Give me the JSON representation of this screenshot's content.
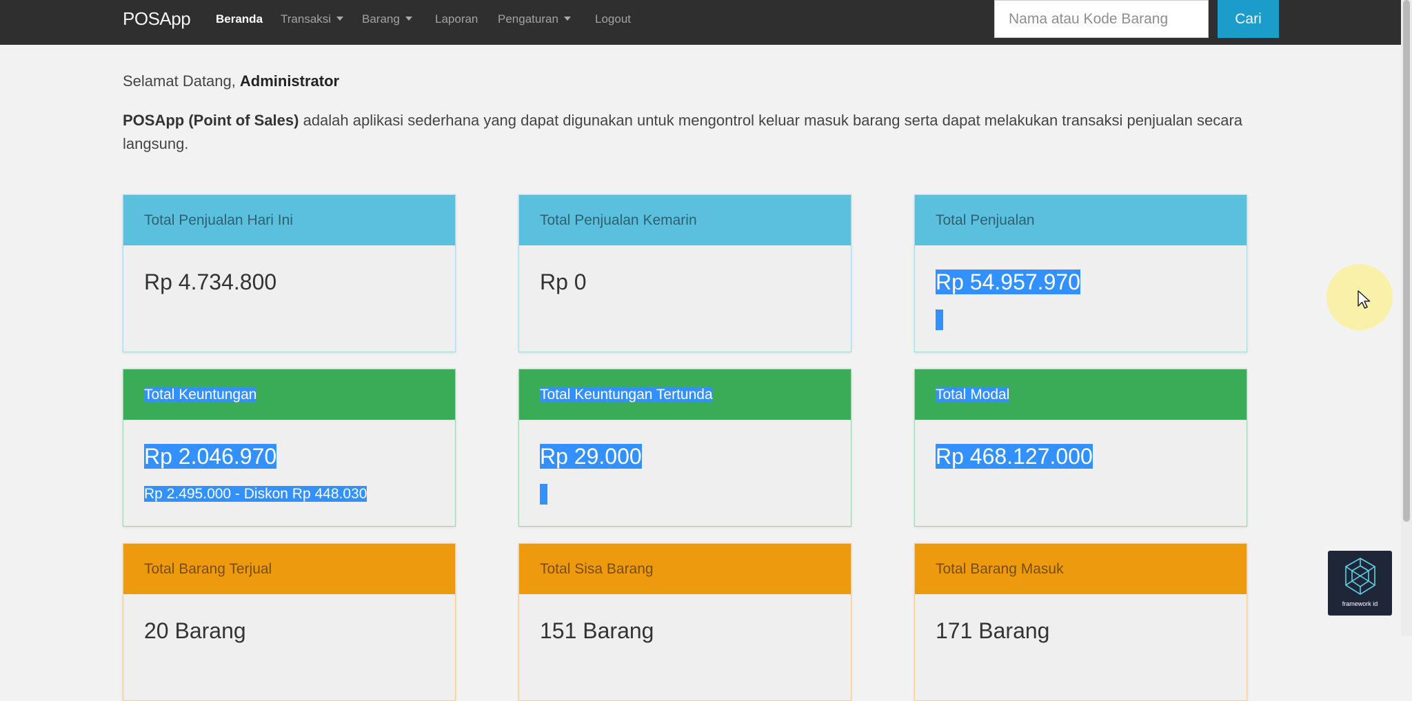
{
  "app": {
    "brand": "POSApp"
  },
  "nav": {
    "items": [
      {
        "label": "Beranda",
        "active": true,
        "dropdown": false
      },
      {
        "label": "Transaksi",
        "active": false,
        "dropdown": true
      },
      {
        "label": "Barang",
        "active": false,
        "dropdown": true
      },
      {
        "label": "Laporan",
        "active": false,
        "dropdown": false
      },
      {
        "label": "Pengaturan",
        "active": false,
        "dropdown": true
      },
      {
        "label": "Logout",
        "active": false,
        "dropdown": false
      }
    ]
  },
  "search": {
    "placeholder": "Nama atau Kode Barang",
    "value": "",
    "button_label": "Cari"
  },
  "welcome": {
    "prefix": "Selamat Datang,",
    "user": "Administrator"
  },
  "description": {
    "strong": "POSApp (Point of Sales)",
    "text": " adalah aplikasi sederhana yang dapat digunakan untuk mengontrol keluar masuk barang serta dapat melakukan transaksi penjualan secara langsung."
  },
  "cards": [
    {
      "variant": "info",
      "title": "Total Penjualan Hari Ini",
      "value": "Rp 4.734.800",
      "note": "",
      "title_selected": false,
      "value_selected": false,
      "note_selected": false,
      "blank_selected": false
    },
    {
      "variant": "info",
      "title": "Total Penjualan Kemarin",
      "value": "Rp 0",
      "note": "",
      "title_selected": false,
      "value_selected": false,
      "note_selected": false,
      "blank_selected": false
    },
    {
      "variant": "info",
      "title": "Total Penjualan",
      "value": "Rp 54.957.970",
      "note": "",
      "title_selected": false,
      "value_selected": true,
      "note_selected": false,
      "blank_selected": true
    },
    {
      "variant": "success",
      "title": "Total Keuntungan",
      "value": "Rp 2.046.970",
      "note": "Rp 2.495.000 - Diskon Rp 448.030",
      "title_selected": true,
      "value_selected": true,
      "note_selected": true,
      "blank_selected": false
    },
    {
      "variant": "success",
      "title": "Total Keuntungan Tertunda",
      "value": "Rp 29.000",
      "note": "",
      "title_selected": true,
      "value_selected": true,
      "note_selected": false,
      "blank_selected": true
    },
    {
      "variant": "success",
      "title": "Total Modal",
      "value": "Rp 468.127.000",
      "note": "",
      "title_selected": true,
      "value_selected": true,
      "note_selected": false,
      "blank_selected": false
    },
    {
      "variant": "warning",
      "title": "Total Barang Terjual",
      "value": "20 Barang",
      "note": "",
      "title_selected": false,
      "value_selected": false,
      "note_selected": false,
      "blank_selected": false
    },
    {
      "variant": "warning",
      "title": "Total Sisa Barang",
      "value": "151 Barang",
      "note": "",
      "title_selected": false,
      "value_selected": false,
      "note_selected": false,
      "blank_selected": false
    },
    {
      "variant": "warning",
      "title": "Total Barang Masuk",
      "value": "171 Barang",
      "note": "",
      "title_selected": false,
      "value_selected": false,
      "note_selected": false,
      "blank_selected": false
    }
  ],
  "theme": {
    "navbar": "#2f2f2f",
    "info": "#5bc0de",
    "success": "#3aac58",
    "warning": "#ed9a0f",
    "selection": "#3391ff",
    "search_button": "#1b9cca"
  },
  "overlay": {
    "cursor_icon": "arrow-pointer-icon",
    "logo_icon": "geodesic-icon",
    "logo_text": "framework id"
  }
}
